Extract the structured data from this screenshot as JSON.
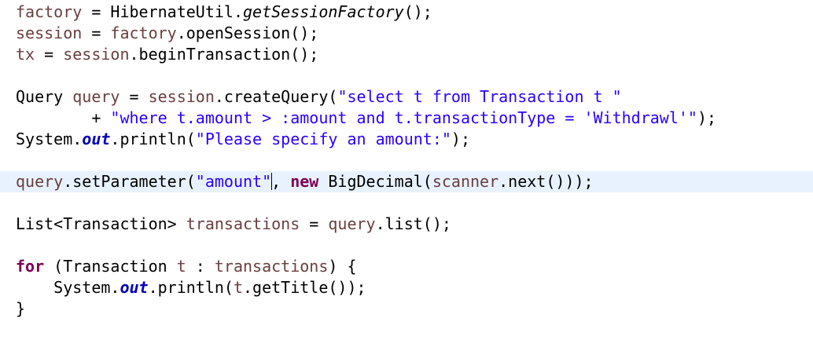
{
  "colors": {
    "background": "#ffffff",
    "current_line": "#e8f2fe",
    "keyword": "#7f0055",
    "variable": "#6a3e3e",
    "string": "#2a00ff",
    "static_field": "#0000c0",
    "plain": "#000000"
  },
  "code": {
    "l1": {
      "a": "factory",
      "b": " = HibernateUtil.",
      "c": "getSessionFactory",
      "d": "();"
    },
    "l2": {
      "a": "session",
      "b": " = ",
      "c": "factory",
      "d": ".openSession();"
    },
    "l3": {
      "a": "tx",
      "b": " = ",
      "c": "session",
      "d": ".beginTransaction();"
    },
    "l5": {
      "a": "Query ",
      "b": "query",
      "c": " = ",
      "d": "session",
      "e": ".createQuery(",
      "f": "\"select t from Transaction t \""
    },
    "l6": {
      "a": "        + ",
      "b": "\"where t.amount > :amount and t.transactionType = 'Withdrawl'\"",
      "c": ");"
    },
    "l7": {
      "a": "System.",
      "b": "out",
      "c": ".println(",
      "d": "\"Please specify an amount:\"",
      "e": ");"
    },
    "l9": {
      "a": "query",
      "b": ".setParameter(",
      "c": "\"amount\"",
      "d": ", ",
      "e": "new",
      "f": " BigDecimal(",
      "g": "scanner",
      "h": ".next()));"
    },
    "l11": {
      "a": "List<Transaction> ",
      "b": "transactions",
      "c": " = ",
      "d": "query",
      "e": ".list();"
    },
    "l13": {
      "a": "for",
      "b": " (Transaction ",
      "c": "t",
      "d": " : ",
      "e": "transactions",
      "f": ") {"
    },
    "l14": {
      "a": "    System.",
      "b": "out",
      "c": ".println(",
      "d": "t",
      "e": ".getTitle());"
    },
    "l15": {
      "a": "}"
    }
  }
}
